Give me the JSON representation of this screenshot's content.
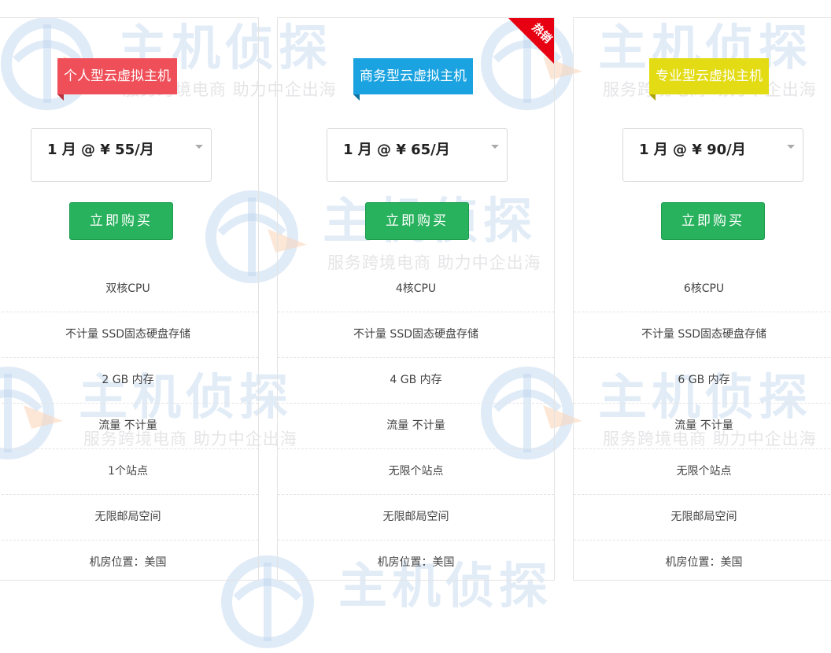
{
  "watermark": {
    "title": "主机侦探",
    "slogan": "服务跨境电商 助力中企出海",
    "colors": {
      "logo_blue": "#8fb6e3",
      "logo_orange": "#f5b07a"
    }
  },
  "cards": [
    {
      "plan_name": "个人型云虚拟主机",
      "ribbon_color": "#ef4f58",
      "ribbon_fold_color": "#b8323b",
      "period_selected": "1 月 @ ¥ 55/月",
      "buy_label": "立即购买",
      "features": [
        "双核CPU",
        "不计量 SSD固态硬盘存储",
        "2 GB 内存",
        "流量 不计量",
        "1个站点",
        "无限邮局空间",
        "机房位置：美国"
      ]
    },
    {
      "plan_name": "商务型云虚拟主机",
      "ribbon_color": "#1aa3e0",
      "ribbon_fold_color": "#10729f",
      "hot_badge": "热销",
      "hot_color": "#e60012",
      "period_selected": "1 月 @ ¥ 65/月",
      "buy_label": "立即购买",
      "features": [
        "4核CPU",
        "不计量 SSD固态硬盘存储",
        "4 GB 内存",
        "流量 不计量",
        "无限个站点",
        "无限邮局空间",
        "机房位置：美国"
      ]
    },
    {
      "plan_name": "专业型云虚拟主机",
      "ribbon_color": "#e3dc14",
      "ribbon_fold_color": "#a8a20c",
      "period_selected": "1 月 @ ¥ 90/月",
      "buy_label": "立即购买",
      "features": [
        "6核CPU",
        "不计量 SSD固态硬盘存储",
        "6 GB 内存",
        "流量 不计量",
        "无限个站点",
        "无限邮局空间",
        "机房位置：美国"
      ]
    }
  ]
}
